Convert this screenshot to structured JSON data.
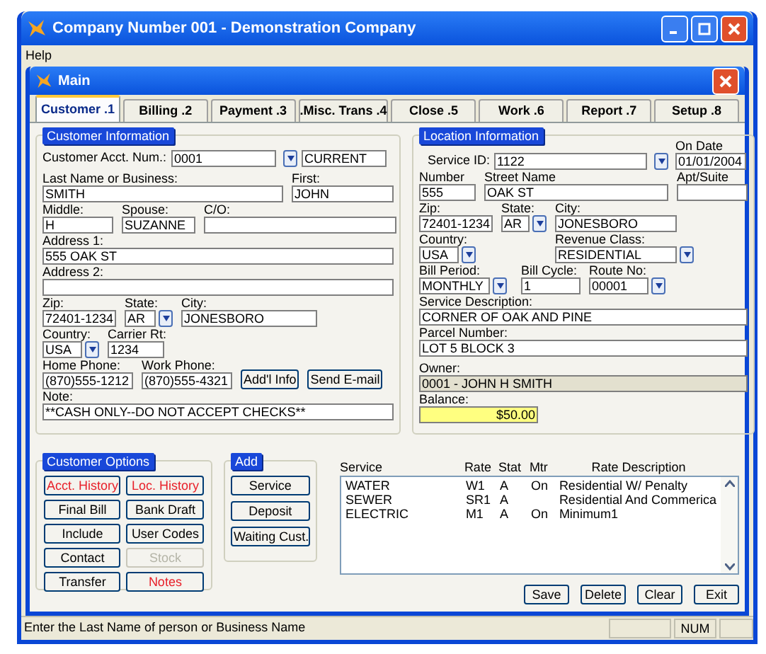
{
  "window": {
    "title": "Company Number 001 - Demonstration Company"
  },
  "menu": [
    "Help"
  ],
  "main": {
    "title": "Main"
  },
  "tabs": [
    {
      "label": "Customer .1",
      "selected": true
    },
    {
      "label": "Billing .2",
      "selected": false
    },
    {
      "label": "Payment .3",
      "selected": false
    },
    {
      "label": ".Misc. Trans .4",
      "selected": false
    },
    {
      "label": "Close .5",
      "selected": false
    },
    {
      "label": "Work .6",
      "selected": false
    },
    {
      "label": "Report .7",
      "selected": false
    },
    {
      "label": "Setup .8",
      "selected": false
    }
  ],
  "customer_info": {
    "title": "Customer Information",
    "account": {
      "label": "Customer Acct. Num.:",
      "value": "0001",
      "status": "CURRENT"
    },
    "rows": [
      [
        {
          "label": "Last Name or Business:",
          "value": "SMITH",
          "dropdown": false
        },
        {
          "label": "First:",
          "value": "JOHN",
          "dropdown": false
        }
      ],
      [
        {
          "label": "Middle:",
          "value": "H",
          "dropdown": false
        },
        {
          "label": "Spouse:",
          "value": "SUZANNE",
          "dropdown": false
        },
        {
          "label": "C/O:",
          "dropdown": false
        }
      ],
      [
        {
          "label": "Address 1:",
          "value": "555 OAK ST",
          "dropdown": false
        }
      ],
      [
        {
          "label": "Address 2:",
          "dropdown": false
        }
      ],
      [
        {
          "label": "Zip:",
          "value": "72401-1234",
          "dropdown": false
        },
        {
          "label": "State:",
          "value": "AR",
          "dropdown": true
        },
        {
          "label": "City:",
          "value": "JONESBORO",
          "dropdown": false
        }
      ],
      [
        {
          "label": "Country:",
          "value": "USA",
          "dropdown": true
        },
        {
          "label": "Carrier Rt:",
          "value": "1234",
          "dropdown": false
        }
      ],
      [
        {
          "label": "Home Phone:",
          "value": "(870)555-1212",
          "dropdown": false
        },
        {
          "label": "Work Phone:",
          "value": "(870)555-4321",
          "dropdown": false
        }
      ],
      [
        {
          "label": "Note:",
          "value": "**CASH ONLY--DO NOT ACCEPT CHECKS**",
          "dropdown": false
        }
      ]
    ],
    "buttons": [
      "Add'l Info",
      "Send E-mail"
    ]
  },
  "location_info": {
    "title": "Location Information",
    "service_id": {
      "label": "Service ID:",
      "value": "1122"
    },
    "on_date": {
      "label": "On Date",
      "value": "01/01/2004"
    },
    "rows": [
      [
        {
          "label": "Number",
          "value": "555",
          "dropdown": false
        },
        {
          "label": "Street Name",
          "value": "OAK ST",
          "dropdown": false
        },
        {
          "label": "Apt/Suite",
          "dropdown": false
        }
      ],
      [
        {
          "label": "Zip:",
          "value": "72401-1234",
          "dropdown": false
        },
        {
          "label": "State:",
          "value": "AR",
          "dropdown": true
        },
        {
          "label": "City:",
          "value": "JONESBORO",
          "dropdown": false
        }
      ],
      [
        {
          "label": "Country:",
          "value": "USA",
          "dropdown": true
        },
        {
          "label": "Revenue Class:",
          "value": "RESIDENTIAL",
          "dropdown": true
        }
      ],
      [
        {
          "label": "Bill Period:",
          "value": "MONTHLY",
          "dropdown": true
        },
        {
          "label": "Bill Cycle:",
          "value": "1",
          "dropdown": false
        },
        {
          "label": "Route No:",
          "value": "00001",
          "dropdown": true
        }
      ],
      [
        {
          "label": "Service Description:",
          "value": "CORNER OF OAK AND PINE",
          "dropdown": false
        }
      ],
      [
        {
          "label": "Parcel Number:",
          "value": "LOT 5 BLOCK 3",
          "dropdown": false
        }
      ]
    ],
    "owner": {
      "label": "Owner:",
      "value": "0001 - JOHN H SMITH"
    },
    "balance": {
      "label": "Balance:",
      "value": "$50.00"
    }
  },
  "customer_options": {
    "title": "Customer Options",
    "buttons": [
      {
        "label": "Acct. History",
        "alert": true,
        "disabled": false
      },
      {
        "label": "Loc. History",
        "alert": true,
        "disabled": false
      },
      {
        "label": "Final Bill",
        "alert": false,
        "disabled": false
      },
      {
        "label": "Bank Draft",
        "alert": false,
        "disabled": false
      },
      {
        "label": "Include",
        "alert": false,
        "disabled": false
      },
      {
        "label": "User Codes",
        "alert": false,
        "disabled": false
      },
      {
        "label": "Contact",
        "alert": false,
        "disabled": false
      },
      {
        "label": "Stock",
        "alert": false,
        "disabled": true
      },
      {
        "label": "Transfer",
        "alert": false,
        "disabled": false
      },
      {
        "label": "Notes",
        "alert": true,
        "disabled": false
      }
    ]
  },
  "add": {
    "title": "Add",
    "buttons": [
      "Service",
      "Deposit",
      "Waiting Cust."
    ]
  },
  "services": {
    "columns": [
      "Service",
      "Rate",
      "Stat",
      "Mtr",
      "Rate Description"
    ],
    "rows": [
      [
        "WATER",
        "W1",
        "A",
        "On",
        "Residential W/ Penalty"
      ],
      [
        "SEWER",
        "SR1",
        "A",
        "",
        "Residential And Commerica"
      ],
      [
        "ELECTRIC",
        "M1",
        "A",
        "On",
        "Minimum1"
      ]
    ]
  },
  "actions": [
    "Save",
    "Delete",
    "Clear",
    "Exit"
  ],
  "status_bar": {
    "message": "Enter the Last Name of person or Business Name",
    "indicators": [
      "NUM"
    ]
  }
}
